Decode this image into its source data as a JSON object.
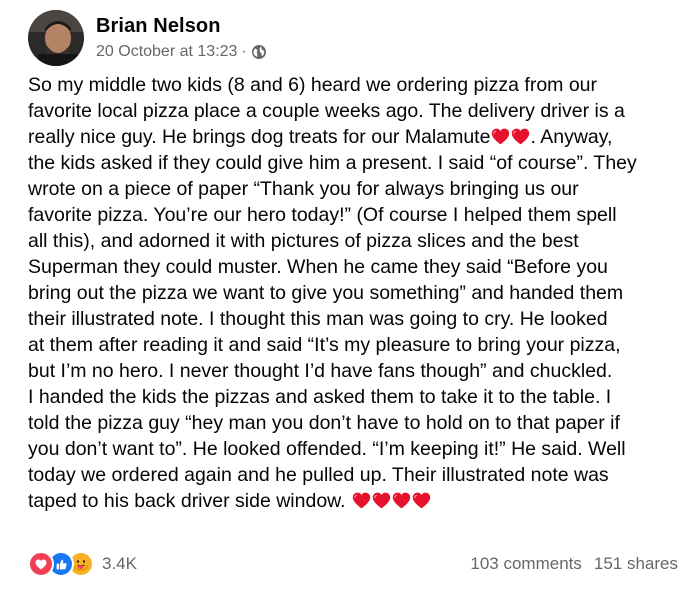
{
  "post": {
    "author": "Brian Nelson",
    "timestamp": "20 October at 13:23",
    "separator": "·",
    "privacy_icon": "globe-icon",
    "body_lines": [
      "So my middle two kids (8 and 6) heard we ordering pizza from our",
      "favorite local pizza place a couple weeks ago. The delivery driver is a",
      "really nice guy. He brings dog treats for our Malamute",
      ". Anyway,",
      "the kids asked if they could give him a present. I said “of course”. They",
      "wrote on a piece of paper “Thank you for always bringing us our",
      "favorite pizza. You’re our hero today!” (Of course I helped them spell",
      "all this), and adorned it with pictures of pizza slices and the best",
      "Superman they could muster. When he came they said “Before you",
      "bring out the pizza we want to give you something” and handed them",
      "their illustrated note. I thought this man was going to cry. He looked",
      "at them after reading it and said “It’s my pleasure to bring your pizza,",
      "but I’m no hero. I never thought I’d have fans though” and chuckled.",
      "I handed the kids the pizzas and asked them to take it to the table. I",
      "told the pizza guy “hey man you don’t have to hold on to that paper if",
      "you don’t want to”. He looked offended. “I’m keeping it!” He said. Well",
      "today we ordered again and he pulled up. Their illustrated note was",
      "taped to his back driver side window. "
    ],
    "emoji_icon": "red-heart-icon"
  },
  "reactions": {
    "icons": [
      "love-reaction-icon",
      "like-reaction-icon",
      "care-reaction-icon"
    ],
    "count": "3.4K"
  },
  "stats": {
    "comments": "103 comments",
    "shares": "151 shares"
  },
  "colors": {
    "text": "#050505",
    "secondary": "#65676b",
    "love": "#f33e58",
    "like": "#1877f2",
    "care": "#f7b125",
    "heart": "#e8112d"
  }
}
